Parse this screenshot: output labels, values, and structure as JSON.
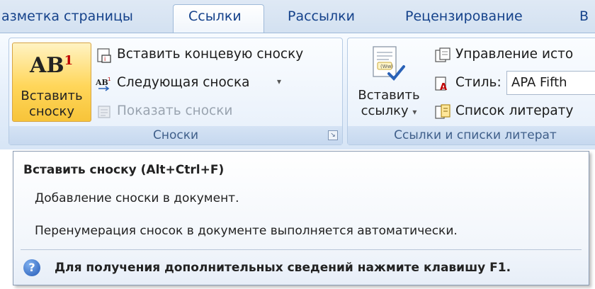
{
  "tabs": [
    {
      "label": "азметка страницы"
    },
    {
      "label": "Ссылки",
      "active": true
    },
    {
      "label": "Рассылки"
    },
    {
      "label": "Рецензирование"
    },
    {
      "label": "В"
    }
  ],
  "footnotes_group": {
    "title": "Сноски",
    "insert_footnote": {
      "label_line1": "Вставить",
      "label_line2": "сноску"
    },
    "insert_endnote": "Вставить концевую сноску",
    "next_footnote": "Следующая сноска",
    "show_notes": "Показать сноски"
  },
  "citations_group": {
    "title": "Ссылки и списки литерат",
    "insert_citation": {
      "label_line1": "Вставить",
      "label_line2": "ссылку"
    },
    "manage_sources": "Управление исто",
    "style_label": "Стиль:",
    "style_value": "APA Fifth",
    "bibliography": "Список литерату"
  },
  "tooltip": {
    "title": "Вставить сноску (Alt+Ctrl+F)",
    "line1": "Добавление сноски в документ.",
    "line2": "Перенумерация сносок в документе выполняется автоматически.",
    "help": "Для получения дополнительных сведений нажмите клавишу F1."
  },
  "colors": {
    "accent": "#15428b",
    "active_button": "#ffd65a"
  }
}
